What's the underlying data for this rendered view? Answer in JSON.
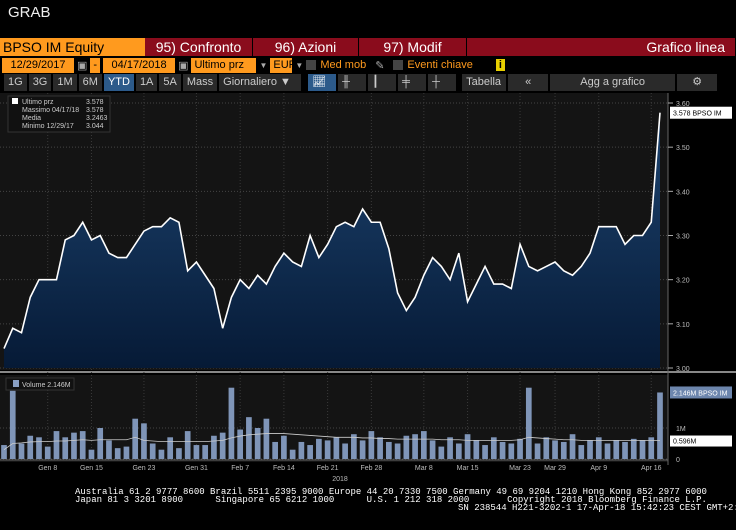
{
  "window": {
    "title": "GRAB"
  },
  "header": {
    "security": "BPSO IM Equity",
    "tabs": [
      "95) Confronto",
      "96) Azioni",
      "97) Modif"
    ],
    "chart_type": "Grafico linea"
  },
  "controls": {
    "start_date": "12/29/2017",
    "sep": "-",
    "end_date": "04/17/2018",
    "field": "Ultimo prz",
    "currency": "EUR",
    "moving_avg": "Med mob",
    "key_events": "Eventi chiave",
    "info": "i"
  },
  "toolbar": {
    "periods": [
      "1G",
      "3G",
      "1M",
      "6M",
      "YTD",
      "1A",
      "5A",
      "Mass"
    ],
    "active": "YTD",
    "frequency": "Giornaliero ▼",
    "table": "Tabella",
    "collapse": "«",
    "add": "Agg a grafico",
    "settings": "⚙"
  },
  "legend": {
    "rows": [
      {
        "label": "Ultimo prz",
        "value": "3.578"
      },
      {
        "label": "Massimo 04/17/18",
        "value": "3.578"
      },
      {
        "label": "Media",
        "value": "3.2463"
      },
      {
        "label": "Minimo 12/29/17",
        "value": "3.044"
      }
    ],
    "volume": "Volume 2.146M"
  },
  "chart_data": {
    "type": "area",
    "price": {
      "ylim": [
        3.0,
        3.6
      ],
      "ticks": [
        "3.60",
        "3.50",
        "3.40",
        "3.30",
        "3.20",
        "3.10",
        "3.00"
      ],
      "last_label": "3.578 BPSO IM",
      "values": [
        3.044,
        3.09,
        3.08,
        3.16,
        3.2,
        3.2,
        3.2,
        3.29,
        3.3,
        3.33,
        3.29,
        3.3,
        3.26,
        3.25,
        3.25,
        3.28,
        3.31,
        3.32,
        3.32,
        3.34,
        3.33,
        3.22,
        3.24,
        3.21,
        3.18,
        3.09,
        3.16,
        3.2,
        3.18,
        3.21,
        3.19,
        3.23,
        3.26,
        3.24,
        3.23,
        3.3,
        3.25,
        3.28,
        3.32,
        3.33,
        3.32,
        3.36,
        3.33,
        3.33,
        3.27,
        3.17,
        3.13,
        3.16,
        3.21,
        3.25,
        3.23,
        3.2,
        3.26,
        3.15,
        3.19,
        3.23,
        3.19,
        3.19,
        3.18,
        3.28,
        3.23,
        3.22,
        3.23,
        3.24,
        3.22,
        3.21,
        3.23,
        3.26,
        3.32,
        3.32,
        3.32,
        3.28,
        3.3,
        3.3,
        3.33,
        3.578
      ]
    },
    "volume": {
      "ylim": [
        0,
        2.6
      ],
      "ticks": [
        "1M",
        "0"
      ],
      "last_label": "2.146M BPSO IM",
      "avg_label": "0.596M",
      "values": [
        0.45,
        2.2,
        0.5,
        0.75,
        0.7,
        0.4,
        0.9,
        0.7,
        0.85,
        0.9,
        0.3,
        1.0,
        0.6,
        0.35,
        0.4,
        1.3,
        1.15,
        0.5,
        0.3,
        0.7,
        0.35,
        0.9,
        0.45,
        0.45,
        0.75,
        0.85,
        2.3,
        0.95,
        1.35,
        1.0,
        1.3,
        0.55,
        0.75,
        0.3,
        0.55,
        0.45,
        0.65,
        0.6,
        0.7,
        0.5,
        0.8,
        0.6,
        0.9,
        0.7,
        0.55,
        0.5,
        0.75,
        0.8,
        0.9,
        0.6,
        0.4,
        0.7,
        0.5,
        0.8,
        0.6,
        0.45,
        0.7,
        0.55,
        0.5,
        0.65,
        2.3,
        0.5,
        0.7,
        0.6,
        0.55,
        0.8,
        0.45,
        0.6,
        0.7,
        0.5,
        0.6,
        0.55,
        0.65,
        0.6,
        0.7,
        2.146
      ],
      "avg": [
        0.3,
        0.5,
        0.52,
        0.55,
        0.56,
        0.56,
        0.58,
        0.58,
        0.6,
        0.62,
        0.6,
        0.62,
        0.62,
        0.62,
        0.62,
        0.7,
        0.6,
        0.58,
        0.56,
        0.56,
        0.56,
        0.56,
        0.56,
        0.56,
        0.58,
        0.6,
        0.68,
        0.74,
        0.78,
        0.8,
        0.82,
        0.82,
        0.82,
        0.8,
        0.78,
        0.76,
        0.74,
        0.72,
        0.7,
        0.7,
        0.7,
        0.68,
        0.68,
        0.66,
        0.66,
        0.64,
        0.64,
        0.64,
        0.64,
        0.64,
        0.62,
        0.62,
        0.62,
        0.6,
        0.6,
        0.6,
        0.6,
        0.6,
        0.6,
        0.62,
        0.7,
        0.68,
        0.66,
        0.64,
        0.62,
        0.62,
        0.6,
        0.6,
        0.6,
        0.6,
        0.6,
        0.6,
        0.6,
        0.6,
        0.6,
        0.596
      ]
    },
    "xticks": [
      {
        "label": "Gen 8",
        "i": 5
      },
      {
        "label": "Gen 15",
        "i": 10
      },
      {
        "label": "Gen 23",
        "i": 16
      },
      {
        "label": "Gen 31",
        "i": 22
      },
      {
        "label": "Feb 7",
        "i": 27
      },
      {
        "label": "Feb 14",
        "i": 32
      },
      {
        "label": "Feb 21",
        "i": 37
      },
      {
        "label": "Feb 28",
        "i": 42
      },
      {
        "label": "Mar 8",
        "i": 48
      },
      {
        "label": "Mar 15",
        "i": 53
      },
      {
        "label": "Mar 23",
        "i": 59
      },
      {
        "label": "Mar 29",
        "i": 63
      },
      {
        "label": "Apr 9",
        "i": 68
      },
      {
        "label": "Apr 16",
        "i": 74
      }
    ],
    "year": "2018"
  },
  "footer": {
    "line1": "Australia 61 2 9777 8600 Brazil 5511 2395 9000 Europe 44 20 7330 7500 Germany 49 69 9204 1210 Hong Kong 852 2977 6000",
    "line2": "Japan 81 3 3201 8900      Singapore 65 6212 1000      U.S. 1 212 318 2000       Copyright 2018 Bloomberg Finance L.P.",
    "line3": "SN 238544 H221-3202-1 17-Apr-18 15:42:23 CEST GMT+2:00"
  }
}
